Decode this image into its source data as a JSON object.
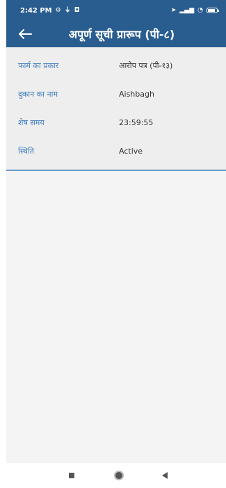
{
  "status_bar": {
    "time": "2:42 PM",
    "icons": [
      "settings-icon",
      "usb-icon",
      "notification-icon",
      "location-icon",
      "signal-icon",
      "wifi-icon",
      "battery-icon"
    ]
  },
  "app_bar": {
    "title": "अपूर्ण सूची प्रारूप (पी-८)",
    "back_icon": "arrow-left-icon"
  },
  "details": [
    {
      "label": "फार्म का प्रकार",
      "value": "आरोप पत्र (पी-१३)"
    },
    {
      "label": "दुकान का नाम",
      "value": "Aishbagh"
    },
    {
      "label": "शेष समय",
      "value": "23:59:55"
    },
    {
      "label": "स्थिति",
      "value": "Active"
    }
  ],
  "colors": {
    "header": "#2a5d8f",
    "label": "#3f7fbf",
    "divider": "#6a9ac9"
  },
  "nav_bar": {
    "icons": [
      "recents-square-icon",
      "home-circle-icon",
      "back-triangle-icon"
    ]
  }
}
